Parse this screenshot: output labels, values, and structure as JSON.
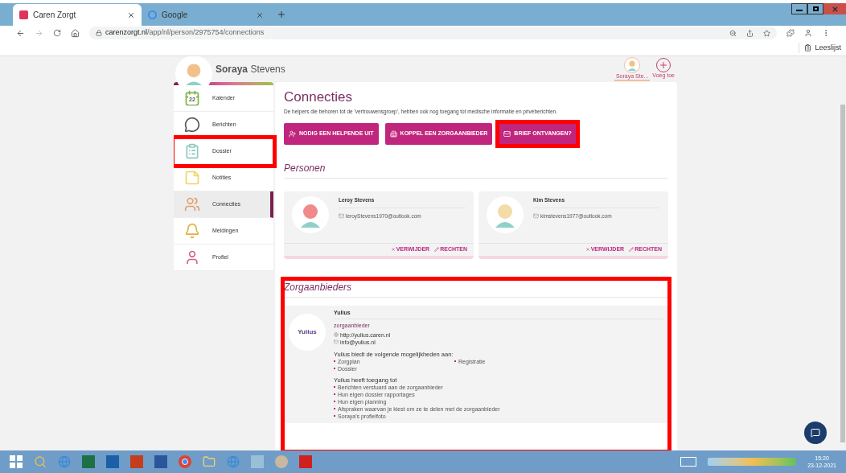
{
  "browser": {
    "tabs": [
      {
        "title": "Caren Zorgt",
        "kind": "caren",
        "selected": true
      },
      {
        "title": "Google",
        "kind": "google",
        "selected": false
      }
    ],
    "url_domain": "carenzorgt.nl",
    "url_path": "/app/nl/person/2975754/connections",
    "reading_list": "Leeslijst"
  },
  "header": {
    "first_name": "Soraya",
    "last_name": "Stevens",
    "profiles": [
      {
        "label": "Soraya Ste...",
        "kind": "person",
        "selected": true
      },
      {
        "label": "Voeg toe",
        "kind": "add",
        "selected": false
      }
    ]
  },
  "sidebar": {
    "items": [
      {
        "label": "Kalender",
        "kind": "calendar",
        "badge": "22",
        "selected": false,
        "highlighted": false
      },
      {
        "label": "Berichten",
        "kind": "messages",
        "selected": false,
        "highlighted": false
      },
      {
        "label": "Dossier",
        "kind": "file",
        "selected": false,
        "highlighted": true
      },
      {
        "label": "Notities",
        "kind": "notes",
        "selected": false,
        "highlighted": false
      },
      {
        "label": "Connecties",
        "kind": "people",
        "selected": true,
        "highlighted": false
      },
      {
        "label": "Meldingen",
        "kind": "bell",
        "selected": false,
        "highlighted": false
      },
      {
        "label": "Profiel",
        "kind": "person",
        "selected": false,
        "highlighted": false
      }
    ]
  },
  "main": {
    "title": "Connecties",
    "intro": "De helpers die behoren tot de 'vertrouwensgroep', hebben ook nog toegang tot medische informatie en privéberichten.",
    "actions": [
      {
        "label": "NODIG EEN HELPENDE UIT",
        "kind": "invite",
        "highlighted": false
      },
      {
        "label": "KOPPEL EEN ZORGAANBIEDER",
        "kind": "link",
        "highlighted": false
      },
      {
        "label": "BRIEF ONTVANGEN?",
        "kind": "mail",
        "highlighted": true
      }
    ],
    "persons": {
      "heading": "Personen",
      "cards": [
        {
          "name": "Leroy Stevens",
          "email": "leroyStevens1970@outlook.com",
          "actions": [
            "VERWIJDER",
            "RECHTEN"
          ]
        },
        {
          "name": "Kim Stevens",
          "email": "kimstevens1977@outlook.com",
          "actions": [
            "VERWIJDER",
            "RECHTEN"
          ]
        }
      ]
    },
    "providers": {
      "heading": "Zorgaanbieders",
      "highlighted": true,
      "cards": [
        {
          "name": "Yulius",
          "logo": "Yulius",
          "type": "zorgaanbieder",
          "website": "http://yulius.caren.nl",
          "email": "info@yulius.nl",
          "offers_heading": "Yulius biedt de volgende mogelijkheden aan:",
          "offers": [
            "Zorgplan",
            "Registratie",
            "Dossier"
          ],
          "access_heading": "Yulius heeft toegang tot",
          "access": [
            "Berichten verstuard aan de zorgaanbieder",
            "Hun eigen dossier rapportages",
            "Hun eigen planning",
            "Afspraken waarvan je kiest om ze te delen met de zorgaanbieder",
            "Soraya's profielfoto"
          ]
        }
      ]
    }
  },
  "taskbar": {
    "time": "15:20",
    "date": "23-12-2021"
  }
}
